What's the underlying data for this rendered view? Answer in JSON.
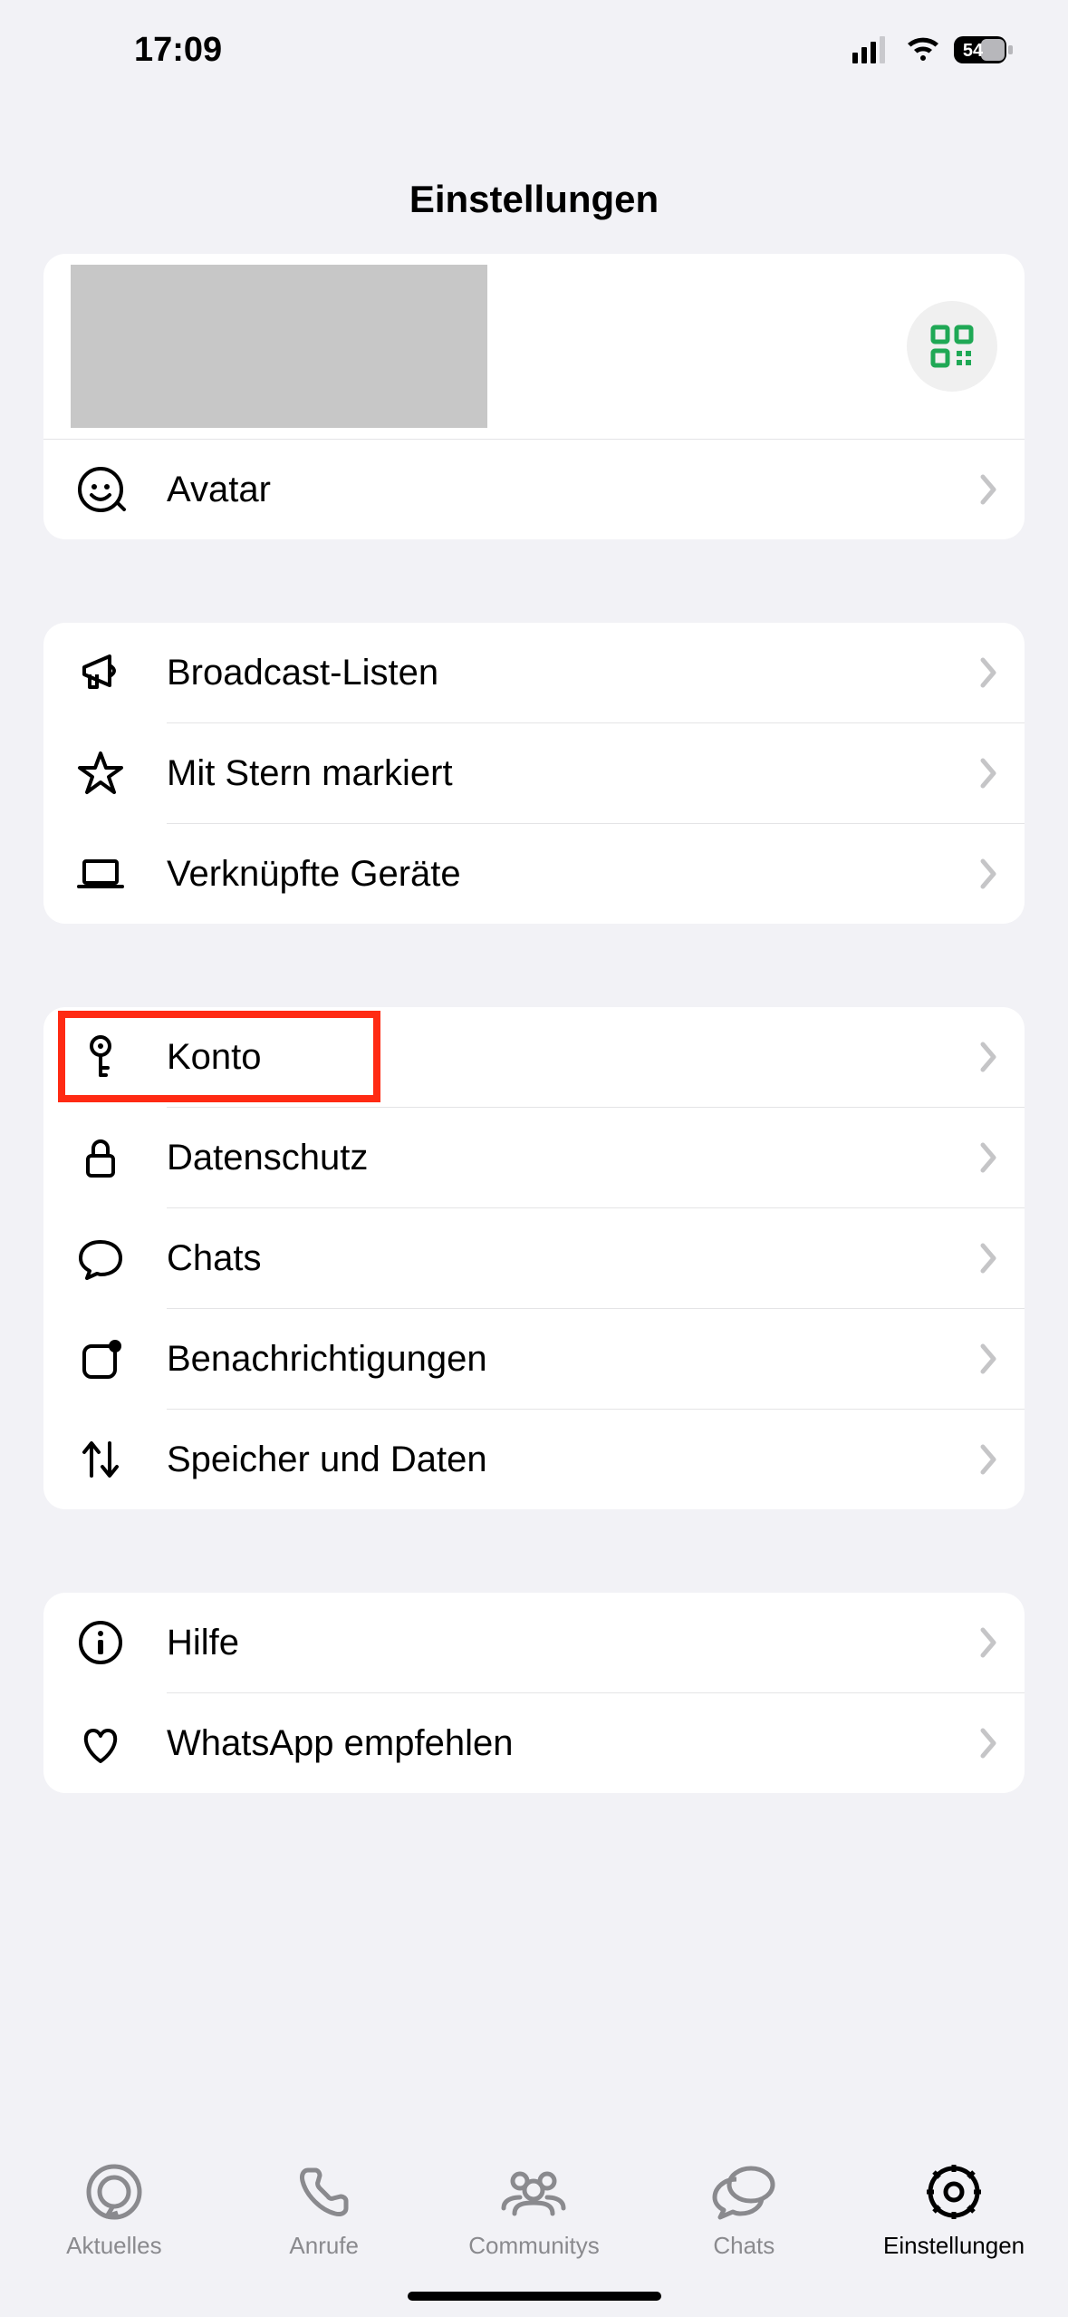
{
  "status": {
    "time": "17:09",
    "battery": "54"
  },
  "title": "Einstellungen",
  "qr_color": "#1fa855",
  "chevron_color": "#c5c5c7",
  "highlight_color": "#ff2a13",
  "sections": [
    {
      "profile": true,
      "items": [
        {
          "key": "avatar",
          "label": "Avatar",
          "icon": "avatar-face-icon"
        }
      ]
    },
    {
      "items": [
        {
          "key": "broadcast",
          "label": "Broadcast-Listen",
          "icon": "megaphone-icon"
        },
        {
          "key": "starred",
          "label": "Mit Stern markiert",
          "icon": "star-icon"
        },
        {
          "key": "linked-devices",
          "label": "Verknüpfte Geräte",
          "icon": "laptop-icon"
        }
      ]
    },
    {
      "items": [
        {
          "key": "account",
          "label": "Konto",
          "icon": "key-icon",
          "highlight": true
        },
        {
          "key": "privacy",
          "label": "Datenschutz",
          "icon": "lock-icon"
        },
        {
          "key": "chats",
          "label": "Chats",
          "icon": "chat-bubble-icon"
        },
        {
          "key": "notifications",
          "label": "Benachrichtigungen",
          "icon": "notification-square-icon"
        },
        {
          "key": "storage",
          "label": "Speicher und Daten",
          "icon": "arrows-updown-icon"
        }
      ]
    },
    {
      "items": [
        {
          "key": "help",
          "label": "Hilfe",
          "icon": "info-icon"
        },
        {
          "key": "tell-a-friend",
          "label": "WhatsApp empfehlen",
          "icon": "heart-icon"
        }
      ]
    }
  ],
  "tabbar": {
    "items": [
      {
        "key": "aktuelles",
        "label": "Aktuelles",
        "icon": "status-circle-icon"
      },
      {
        "key": "anrufe",
        "label": "Anrufe",
        "icon": "phone-icon"
      },
      {
        "key": "communitys",
        "label": "Communitys",
        "icon": "people-icon"
      },
      {
        "key": "chats",
        "label": "Chats",
        "icon": "chats-tab-icon"
      },
      {
        "key": "einstellungen",
        "label": "Einstellungen",
        "icon": "gear-icon",
        "active": true
      }
    ]
  }
}
